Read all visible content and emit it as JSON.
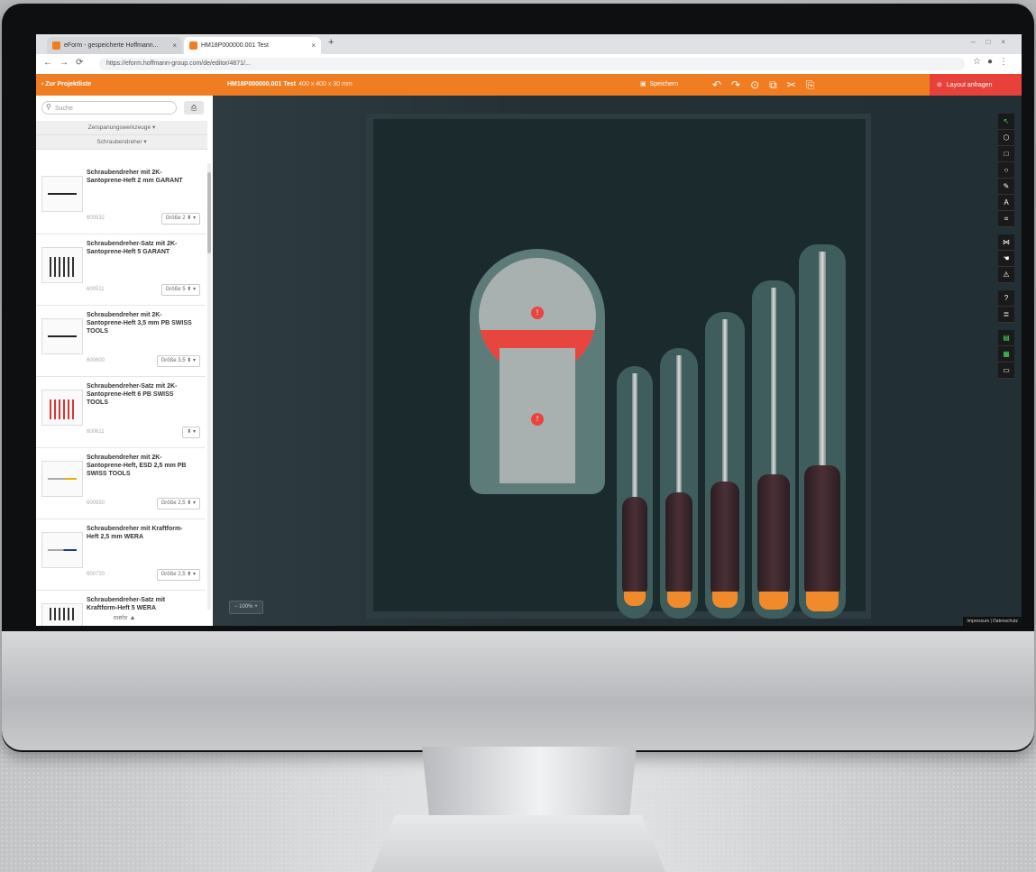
{
  "browser": {
    "tabs": [
      {
        "label": "eForm - gespeicherte Hoffmann..."
      },
      {
        "label": "HM18P000000.001 Test"
      }
    ],
    "new_tab": "+",
    "url": "https://eform.hoffmann-group.com/de/editor/4871/..."
  },
  "appbar": {
    "back_label": "Zur Projektliste",
    "project_title": "HM18P000000.001 Test",
    "project_dims": "400 x 400 x 30 mm",
    "save_label": "Speichern",
    "submit_label": "Layout anfragen",
    "colors": {
      "accent": "#f07d22",
      "submit": "#e8413a"
    }
  },
  "sidebar": {
    "search_placeholder": "Suche",
    "crumbs": [
      "Zerspanungswerkzeuge",
      "Schraubendreher"
    ],
    "items": [
      {
        "name": "Schraubendreher mit 2K-Santoprene-Heft 2 mm GARANT",
        "number": "600532",
        "size": "Größe 2"
      },
      {
        "name": "Schraubendreher-Satz mit 2K-Santoprene-Heft 5 GARANT",
        "number": "600511",
        "size": "Größe 5"
      },
      {
        "name": "Schraubendreher mit 2K-Santoprene-Heft 3,5 mm PB SWISS TOOLS",
        "number": "600600",
        "size": "Größe 3,5"
      },
      {
        "name": "Schraubendreher-Satz mit 2K-Santoprene-Heft 6 PB SWISS TOOLS",
        "number": "600611",
        "size": ""
      },
      {
        "name": "Schraubendreher mit 2K-Santoprene-Heft, ESD 2,5 mm PB SWISS TOOLS",
        "number": "600550",
        "size": "Größe 2,5"
      },
      {
        "name": "Schraubendreher mit Kraftform-Heft 2,5 mm WERA",
        "number": "600720",
        "size": "Größe 2,5"
      },
      {
        "name": "Schraubendreher-Satz mit Kraftform-Heft 5 WERA",
        "number": "",
        "size": ""
      }
    ],
    "more_label": "mehr"
  },
  "canvas": {
    "zoom_label": "100%",
    "footer_label": "Impressum | Datenschutz",
    "warning_glyph": "!"
  }
}
